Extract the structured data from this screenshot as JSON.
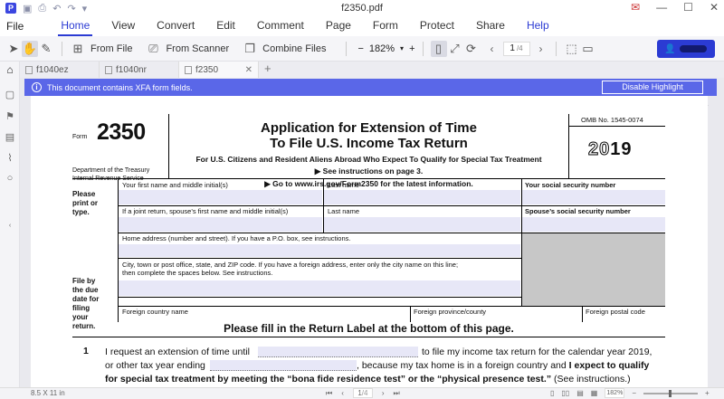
{
  "window": {
    "title": "f2350.pdf"
  },
  "menu": {
    "file": "File",
    "tabs": [
      "Home",
      "View",
      "Convert",
      "Edit",
      "Comment",
      "Page",
      "Form",
      "Protect",
      "Share",
      "Help"
    ],
    "active": "Home"
  },
  "toolbar": {
    "from_file": "From File",
    "from_scanner": "From Scanner",
    "combine_files": "Combine Files",
    "zoom": "182%",
    "page_current": "1",
    "page_total": "/4"
  },
  "doc_tabs": [
    "f1040ez",
    "f1040nr",
    "f2350"
  ],
  "active_doc_tab": "f2350",
  "infobar": {
    "message": "This document contains XFA form fields.",
    "button": "Disable Highlight"
  },
  "form": {
    "form_label": "Form",
    "form_number": "2350",
    "department": [
      "Department of the Treasury",
      "Internal Revenue Service"
    ],
    "title_line1": "Application for Extension of Time",
    "title_line2": "To File U.S. Income Tax Return",
    "subtitle": "For U.S. Citizens and Resident Aliens Abroad Who Expect To Qualify for Special Tax Treatment",
    "instructions": "▶ See instructions on page 3.",
    "goto": "▶ Go to www.irs.gov/Form2350 for the latest information.",
    "omb": "OMB No. 1545-0074",
    "year_outline": "20",
    "year_bold": "19",
    "please_print": [
      "Please",
      "print or",
      "type."
    ],
    "file_by": [
      "File by",
      "the due",
      "date for",
      "filing",
      "your",
      "return."
    ],
    "first_name": "Your first name and middle initial(s)",
    "last_name": "Last name",
    "ssn": "Your social security number",
    "spouse_first": "If a joint return, spouse’s first name and middle initial(s)",
    "spouse_last": "Last name",
    "spouse_ssn": "Spouse’s social security number",
    "home_address": "Home address (number and street). If you have a P.O. box, see instructions.",
    "city_line1": "City, town or post office, state, and ZIP code. If you have a foreign address, enter only the city name on this line;",
    "city_line2": "then complete the spaces below. See instructions.",
    "foreign_country": "Foreign country name",
    "foreign_province": "Foreign province/county",
    "foreign_postal": "Foreign postal code",
    "fill_title": "Please fill in the Return Label at the bottom of this page.",
    "line1_num": "1",
    "line1_a": "I request an extension of time until",
    "line1_b": "to file my income tax return for the calendar year 2019,",
    "line1_c": "or other tax year ending",
    "line1_d": ", because my tax home is in a foreign country and",
    "line1_e": "I expect to qualify",
    "line1_f": "for special tax treatment by meeting the “bona fide residence test” or the “physical presence test.”",
    "line1_g": "(See instructions.)"
  },
  "status": {
    "page_size": "8.5 X 11 in",
    "page": "1",
    "page_total": "/4",
    "zoom": "182%"
  },
  "colors": {
    "accent": "#2b3bd3",
    "infobar": "#5a67e8",
    "field": "#e7e7f7"
  }
}
